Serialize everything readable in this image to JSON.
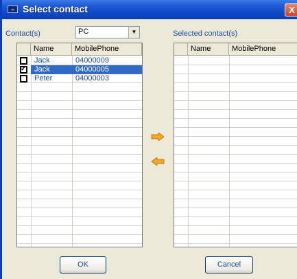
{
  "window": {
    "title": "Select contact",
    "close_glyph": "X"
  },
  "left": {
    "label": "Contact(s)",
    "source": {
      "selected": "PC"
    },
    "columns": [
      "Name",
      "MobilePhone"
    ],
    "rows": [
      {
        "checked": false,
        "name": "Jack",
        "phone": "04000009",
        "selected": false
      },
      {
        "checked": true,
        "name": "Jack",
        "phone": "04000005",
        "selected": true
      },
      {
        "checked": false,
        "name": "Peter",
        "phone": "04000003",
        "selected": false
      }
    ]
  },
  "right": {
    "label": "Selected contact(s)",
    "columns": [
      "Name",
      "MobilePhone"
    ],
    "rows": []
  },
  "buttons": {
    "ok": "OK",
    "cancel": "Cancel"
  },
  "colors": {
    "title_bar": "#0f49c9",
    "selection": "#316ac5",
    "arrow": "#f5a623",
    "label": "#1b4aa8"
  },
  "icons": {
    "add": "arrow-right-icon",
    "remove": "arrow-left-icon"
  }
}
